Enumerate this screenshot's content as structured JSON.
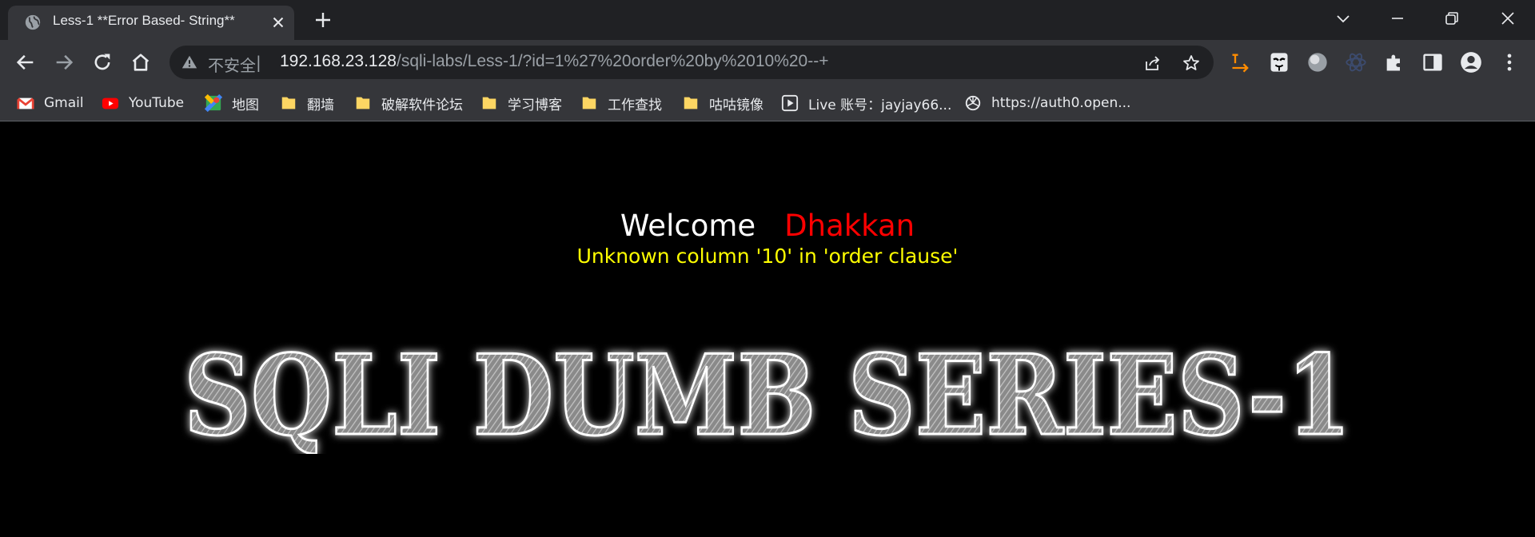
{
  "browser": {
    "tab": {
      "title": "Less-1 **Error Based- String**"
    },
    "omnibox": {
      "security_label": "不安全",
      "separator": "|",
      "url_host": "192.168.23.128",
      "url_path": "/sqli-labs/Less-1/?id=1%27%20order%20by%2010%20--+"
    },
    "bookmarks": [
      {
        "label": "Gmail",
        "icon": "gmail-icon"
      },
      {
        "label": "YouTube",
        "icon": "youtube-icon"
      },
      {
        "label": "地图",
        "icon": "maps-icon"
      },
      {
        "label": "翻墙",
        "icon": "folder-icon"
      },
      {
        "label": "破解软件论坛",
        "icon": "folder-icon"
      },
      {
        "label": "学习博客",
        "icon": "folder-icon"
      },
      {
        "label": "工作查找",
        "icon": "folder-icon"
      },
      {
        "label": "咕咕镜像",
        "icon": "folder-icon"
      },
      {
        "label": "Live  账号：jayjay66...",
        "icon": "play-icon"
      },
      {
        "label": "https://auth0.open...",
        "icon": "openai-icon"
      }
    ]
  },
  "page": {
    "welcome": "Welcome",
    "name": "Dhakkan",
    "error": "Unknown column '10' in 'order clause'",
    "banner": "SQLI DUMB SERIES-1"
  },
  "colors": {
    "welcome": "#ffffff",
    "name": "#ff0000",
    "error": "#ffff00",
    "background": "#000000"
  }
}
